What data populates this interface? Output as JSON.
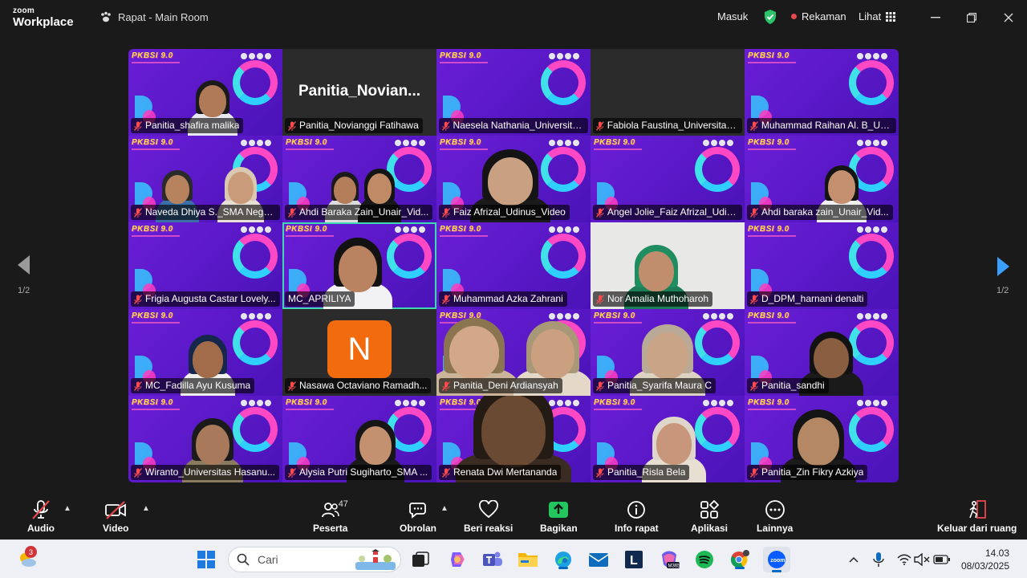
{
  "app": {
    "logo_top": "zoom",
    "logo_bottom": "Workplace",
    "meeting_title": "Rapat - Main Room",
    "signin": "Masuk",
    "recording": "Rekaman",
    "view": "Lihat"
  },
  "pager": {
    "left": "1/2",
    "right": "1/2"
  },
  "tile_brand": "PKBSI 9.0",
  "tiles": [
    {
      "name": "Panitia_shafira malika"
    },
    {
      "name": "Panitia_Novianggi Fatihawa",
      "big": "Panitia_Novian..."
    },
    {
      "name": "Naesela Nathania_Universitas..."
    },
    {
      "name": "Fabiola Faustina_Universitas ..."
    },
    {
      "name": "Muhammad Raihan Al. B_Un..."
    },
    {
      "name": "Naveda Dhiya S._SMA Nege..."
    },
    {
      "name": "Ahdi Baraka Zain_Unair_Vid..."
    },
    {
      "name": "Faiz Afrizal_Udinus_Video"
    },
    {
      "name": "Angel Jolie_Faiz Afrizal_Udin..."
    },
    {
      "name": "Ahdi baraka zain_Unair_Vid..."
    },
    {
      "name": "Frigia Augusta Castar Lovely..."
    },
    {
      "name": "MC_APRILIYA"
    },
    {
      "name": "Muhammad Azka Zahrani"
    },
    {
      "name": "Nor Amalia Muthoharoh"
    },
    {
      "name": "D_DPM_harnani denalti"
    },
    {
      "name": "MC_Fadilla Ayu Kusuma"
    },
    {
      "name": "Nasawa Octaviano Ramadh...",
      "avatar": "N"
    },
    {
      "name": "Panitia_Deni Ardiansyah"
    },
    {
      "name": "Panitia_Syarifa Maura C"
    },
    {
      "name": "Panitia_sandhi"
    },
    {
      "name": "Wiranto_Universitas Hasanu..."
    },
    {
      "name": "Alysia Putri Sugiharto_SMA ..."
    },
    {
      "name": "Renata Dwi Mertananda"
    },
    {
      "name": "Panitia_Risla Bela"
    },
    {
      "name": "Panitia_Zin Fikry Azkiya"
    }
  ],
  "toolbar": {
    "audio": "Audio",
    "video": "Video",
    "participants": "Peserta",
    "participants_count": "47",
    "chat": "Obrolan",
    "react": "Beri reaksi",
    "share": "Bagikan",
    "info": "Info rapat",
    "apps": "Aplikasi",
    "more": "Lainnya",
    "leave": "Keluar dari ruang"
  },
  "taskbar": {
    "weather_badge": "3",
    "search_placeholder": "Cari",
    "time": "14.03",
    "date": "08/03/2025"
  },
  "colors": {
    "accent": "#0b5cff",
    "tile_purple": "#5416c8",
    "active_speaker": "#3ddcb0",
    "recording": "#e5484d",
    "share_green": "#22c55e"
  }
}
